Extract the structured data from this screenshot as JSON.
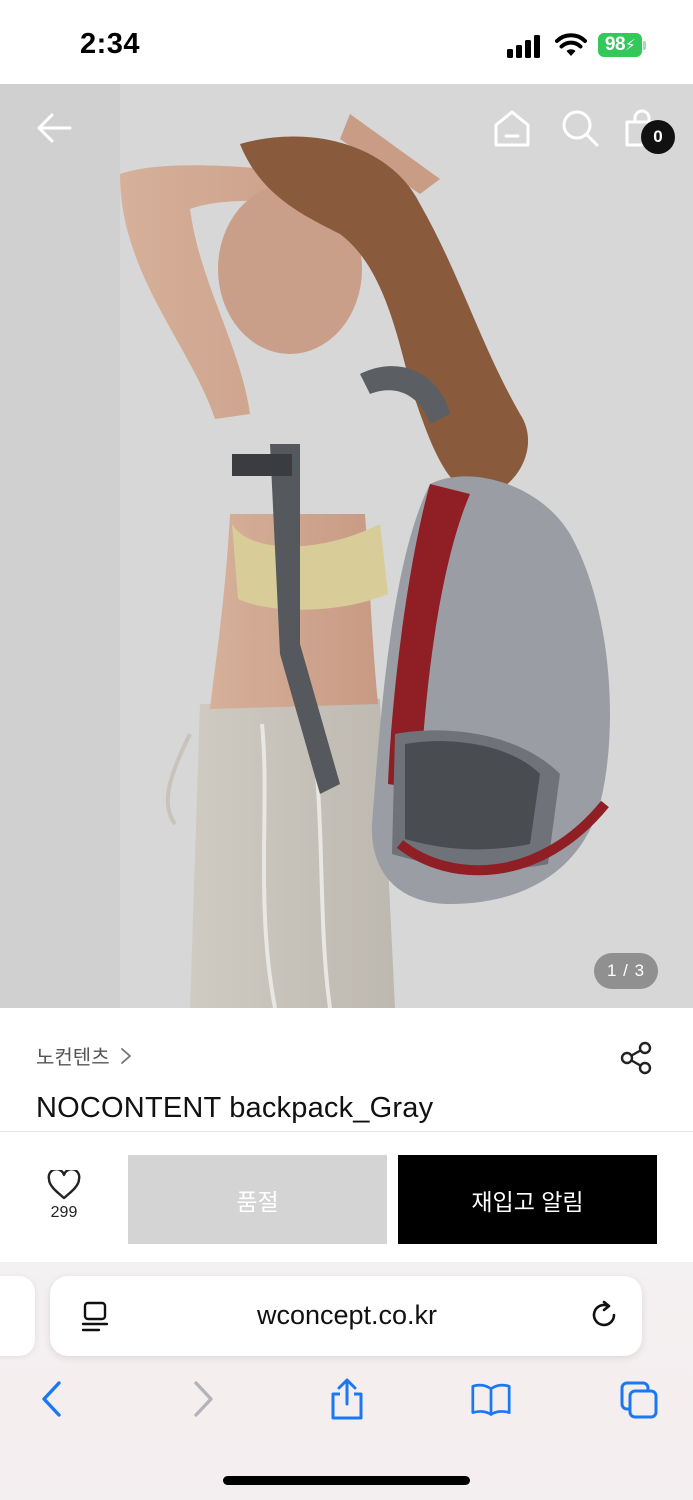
{
  "status_bar": {
    "time": "2:34",
    "battery": "98"
  },
  "hero": {
    "page_counter": "1 / 3",
    "cart_count": "0",
    "icons": {
      "back": "back-arrow-icon",
      "home": "home-icon",
      "search": "search-icon",
      "cart": "shopping-bag-icon"
    }
  },
  "product": {
    "brand": "노컨텐츠",
    "title": "NOCONTENT backpack_Gray",
    "wish_count": "299"
  },
  "actions": {
    "soldout_label": "품절",
    "restock_label": "재입고 알림"
  },
  "browser": {
    "url": "wconcept.co.kr"
  },
  "colors": {
    "soldout_bg": "#d4d4d4",
    "restock_bg": "#000000",
    "safari_blue": "#1a78f2",
    "battery_green": "#34c759"
  }
}
